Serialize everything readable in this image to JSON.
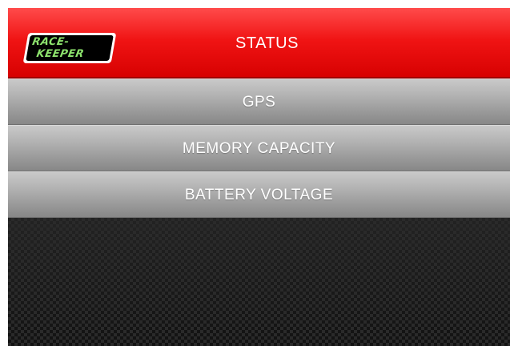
{
  "header": {
    "logo": {
      "line1": "RACE-",
      "line2": "KEEPER"
    },
    "title": "STATUS"
  },
  "menu": {
    "items": [
      {
        "label": "GPS"
      },
      {
        "label": "MEMORY CAPACITY"
      },
      {
        "label": "BATTERY VOLTAGE"
      }
    ]
  },
  "colors": {
    "header": "#f01414",
    "menu": "#b3b3b3",
    "logo_text": "#8de36d",
    "background": "#1a1a1a"
  }
}
